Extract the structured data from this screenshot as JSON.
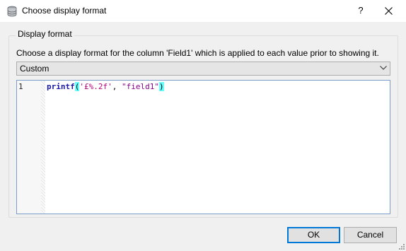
{
  "window": {
    "title": "Choose display format",
    "help_label": "?",
    "icons": {
      "app": "database-icon",
      "close": "close-icon"
    }
  },
  "group": {
    "title": "Display format",
    "description": "Choose a display format for the column 'Field1' which is applied to each value prior to showing it."
  },
  "format_select": {
    "selected": "Custom",
    "icon": "chevron-down-icon"
  },
  "editor": {
    "line_numbers": [
      "1"
    ],
    "code": {
      "function": "printf",
      "open_paren": "(",
      "arg1": "'£%.2f'",
      "separator": ", ",
      "arg2": "\"field1\"",
      "close_paren": ")"
    }
  },
  "buttons": {
    "ok": "OK",
    "cancel": "Cancel"
  },
  "colors": {
    "accent": "#0078d7",
    "paren_highlight": "#66ffff",
    "function": "#1a1aa6",
    "string": "#b8007a"
  }
}
